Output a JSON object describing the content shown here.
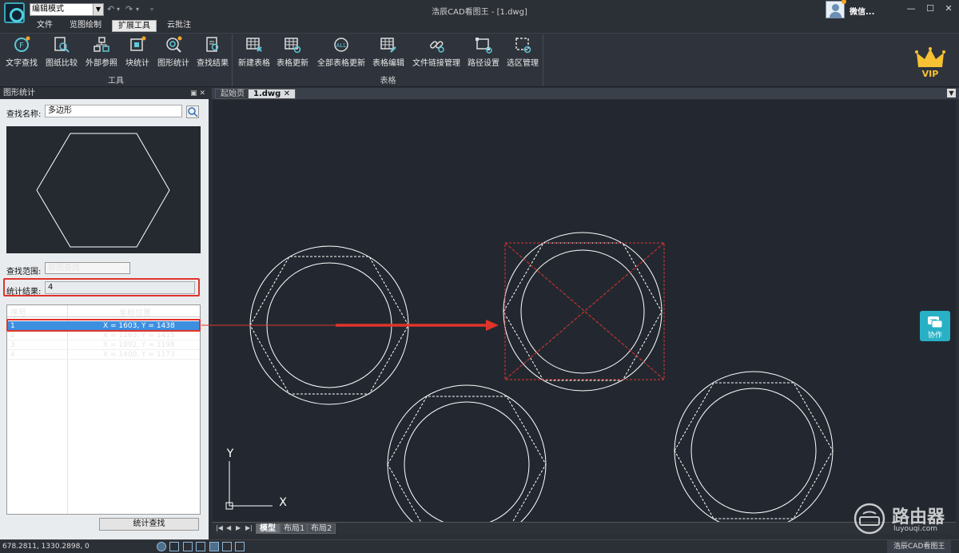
{
  "titlebar": {
    "mode_select": "编辑模式",
    "window_title": "浩辰CAD看图王 - [1.dwg]",
    "user_name": "微信..."
  },
  "menu": {
    "tabs": [
      "文件",
      "览图绘制",
      "扩展工具",
      "云批注"
    ],
    "active_tab": "扩展工具"
  },
  "ribbon": {
    "tools_group": {
      "label": "工具",
      "buttons": [
        "文字查找",
        "图纸比较",
        "外部参照",
        "块统计",
        "图形统计",
        "查找结果"
      ]
    },
    "table_group": {
      "label": "表格",
      "buttons": [
        "新建表格",
        "表格更新",
        "全部表格更新",
        "表格编辑",
        "文件链接管理",
        "路径设置",
        "选区管理"
      ]
    },
    "vip_label": "VIP"
  },
  "panel": {
    "title": "图形统计",
    "search_name_label": "查找名称:",
    "search_name_value": "多边形",
    "scope_label": "查找范围:",
    "scope_value": "整图查找",
    "result_label": "统计结果:",
    "result_value": "4",
    "table": {
      "headers": [
        "序号",
        "坐标位置"
      ],
      "rows": [
        {
          "index": "1",
          "position": "X = 1603, Y = 1438"
        },
        {
          "index": "2",
          "position": "X = 1163, Y = 1415"
        },
        {
          "index": "3",
          "position": "X = 1892, Y = 1198"
        },
        {
          "index": "4",
          "position": "X = 1400, Y = 1173"
        }
      ],
      "selected_row": 0
    },
    "stat_button": "统计查找"
  },
  "document": {
    "tabs": [
      "起始页",
      "1.dwg"
    ],
    "active_tab": "1.dwg",
    "layout_tabs": [
      "模型",
      "布局1",
      "布局2"
    ],
    "active_layout": "模型",
    "ucs_x_label": "X",
    "ucs_y_label": "Y",
    "collab_label": "协作"
  },
  "watermark": {
    "text": "路由器",
    "url": "luyouqi.com"
  },
  "statusbar": {
    "coordinates": "678.2811, 1330.2898, 0",
    "app_name": "浩辰CAD看图王"
  },
  "colors": {
    "highlight_red": "#e0342b",
    "selection_blue": "#3d8fe0",
    "accent_cyan": "#28b1c6"
  }
}
